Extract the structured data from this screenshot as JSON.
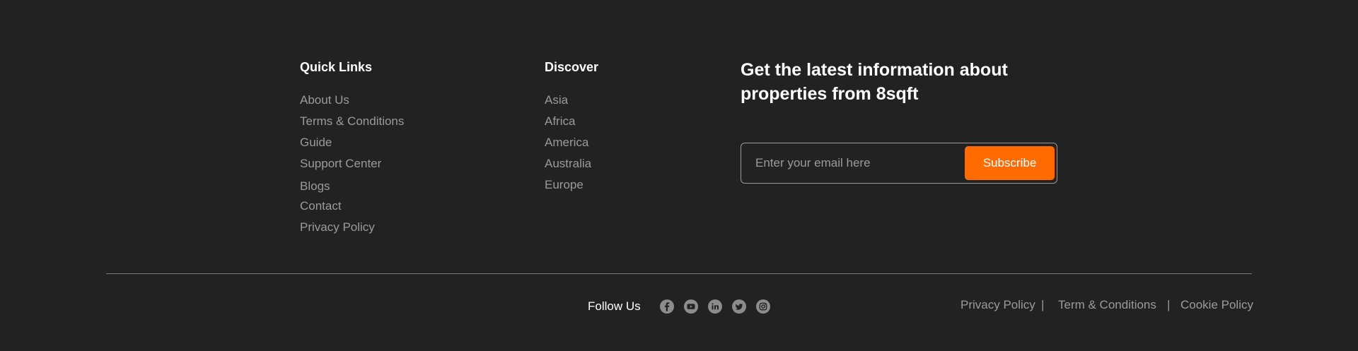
{
  "quick_links": {
    "title": "Quick Links",
    "items": [
      "About Us",
      "Terms & Conditions",
      "Guide",
      "Support Center",
      "Blogs",
      "Contact",
      "Privacy Policy"
    ]
  },
  "discover": {
    "title": "Discover",
    "items": [
      "Asia",
      "Africa",
      "America",
      "Australia",
      "Europe"
    ]
  },
  "newsletter": {
    "heading": "Get the latest information about properties from 8sqft",
    "placeholder": "Enter your email here",
    "button_label": "Subscribe"
  },
  "bottom_bar": {
    "follow_label": "Follow Us",
    "social_icons": [
      "facebook-icon",
      "youtube-icon",
      "linkedin-icon",
      "twitter-icon",
      "instagram-icon"
    ],
    "legal_links": [
      "Privacy Policy",
      "Term & Conditions",
      "Cookie Policy"
    ],
    "separator": "|"
  },
  "colors": {
    "background": "#222222",
    "accent": "#ff6b00",
    "muted_text": "#9b9b9b",
    "heading_text": "#ffffff"
  }
}
